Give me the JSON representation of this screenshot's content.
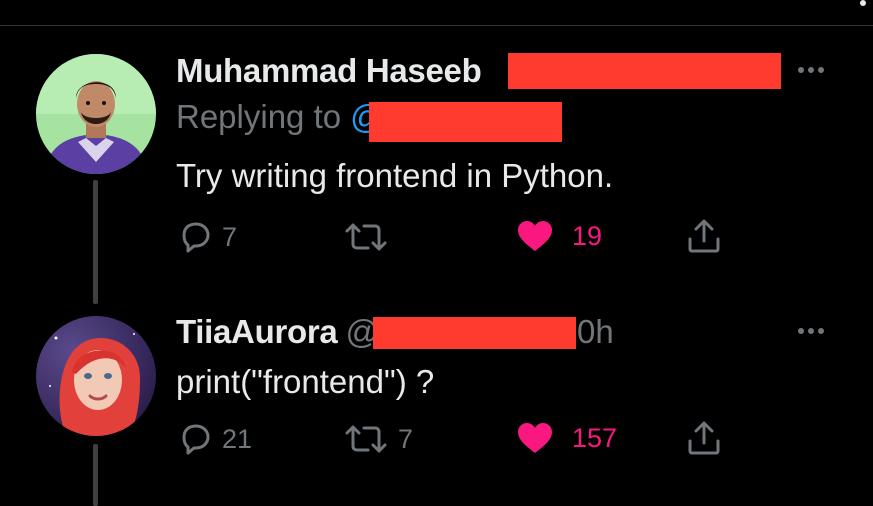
{
  "colors": {
    "background": "#000000",
    "text": "#e7e9ea",
    "muted": "#71767b",
    "mention": "#1d9bf0",
    "like": "#f91880",
    "redaction": "#ff3b30"
  },
  "tweets": [
    {
      "author_name": "Muhammad Haseeb",
      "replying_label": "Replying to",
      "replying_mention": "@",
      "text": "Try writing frontend in Python.",
      "reply_count": "7",
      "retweet_count": "",
      "like_count": "19",
      "icons": [
        "reply-icon",
        "retweet-icon",
        "heart-filled-icon",
        "share-icon",
        "more-icon"
      ]
    },
    {
      "author_name": "TiiaAurora",
      "author_handle": "@",
      "time": "0h",
      "text": "print(\"frontend\") ?",
      "reply_count": "21",
      "retweet_count": "7",
      "like_count": "157",
      "icons": [
        "reply-icon",
        "retweet-icon",
        "heart-filled-icon",
        "share-icon",
        "more-icon"
      ]
    }
  ]
}
